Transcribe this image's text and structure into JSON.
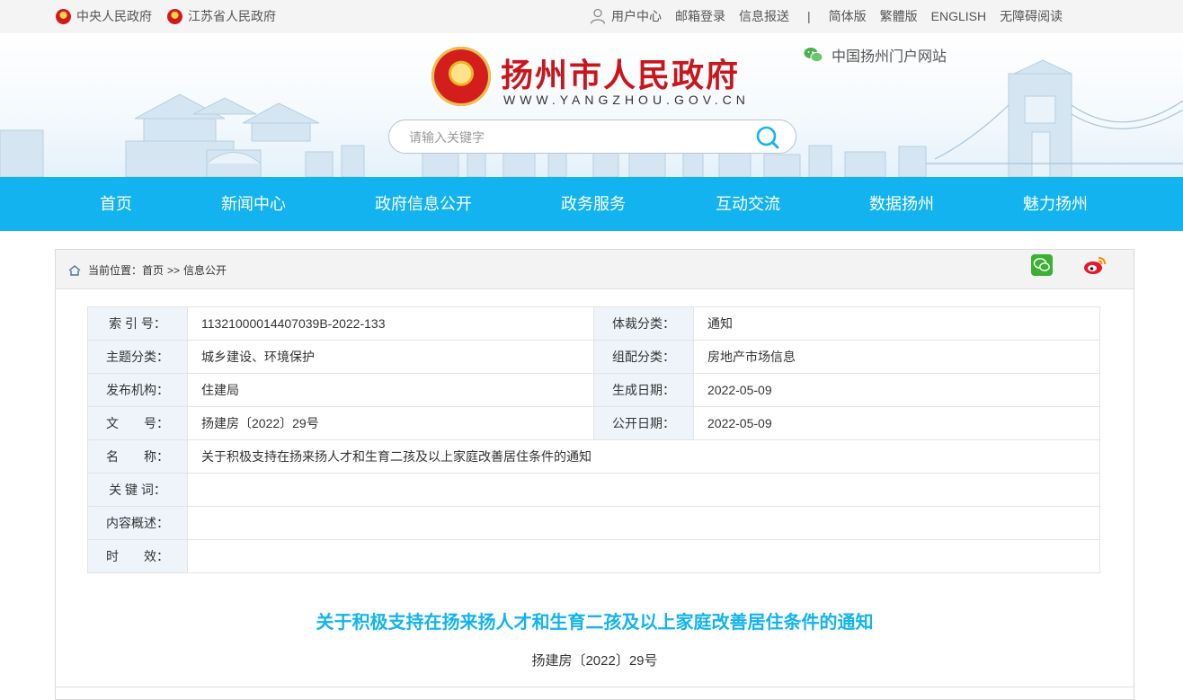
{
  "topbar": {
    "central_gov": "中央人民政府",
    "province_gov": "江苏省人民政府",
    "user_center": "用户中心",
    "mail_login": "邮箱登录",
    "info_report": "信息报送",
    "divider": "|",
    "simplified": "简体版",
    "traditional": "繁體版",
    "english": "ENGLISH",
    "accessible": "无障碍阅读"
  },
  "header": {
    "site_title": "扬州市人民政府",
    "site_domain": "WWW.YANGZHOU.GOV.CN",
    "portal_label": "中国扬州门户网站",
    "search_placeholder": "请输入关键字"
  },
  "nav": {
    "items": [
      "首页",
      "新闻中心",
      "政府信息公开",
      "政务服务",
      "互动交流",
      "数据扬州",
      "魅力扬州"
    ]
  },
  "breadcrumb": {
    "prefix": "当前位置：",
    "home": "首页",
    "separator": ">>",
    "current": "信息公开"
  },
  "info_table": {
    "index_label": "索 引 号：",
    "index_value": "11321000014407039B-2022-133",
    "genre_label": "体裁分类：",
    "genre_value": "通知",
    "topic_label": "主题分类：",
    "topic_value": "城乡建设、环境保护",
    "group_label": "组配分类：",
    "group_value": "房地产市场信息",
    "publisher_label": "发布机构：",
    "publisher_value": "住建局",
    "created_label": "生成日期：",
    "created_value": "2022-05-09",
    "docno_label": "文　　号：",
    "docno_value": "扬建房〔2022〕29号",
    "public_label": "公开日期：",
    "public_value": "2022-05-09",
    "name_label": "名　　称：",
    "name_value": "关于积极支持在扬来扬人才和生育二孩及以上家庭改善居住条件的通知",
    "keywords_label": "关 键 词：",
    "keywords_value": "",
    "summary_label": "内容概述：",
    "summary_value": "",
    "validity_label": "时　　效：",
    "validity_value": ""
  },
  "document": {
    "title": "关于积极支持在扬来扬人才和生育二孩及以上家庭改善居住条件的通知",
    "number": "扬建房〔2022〕29号"
  },
  "colors": {
    "nav_bg": "#12b3ef",
    "title_red": "#c8161d",
    "doc_title": "#12b3ef"
  }
}
